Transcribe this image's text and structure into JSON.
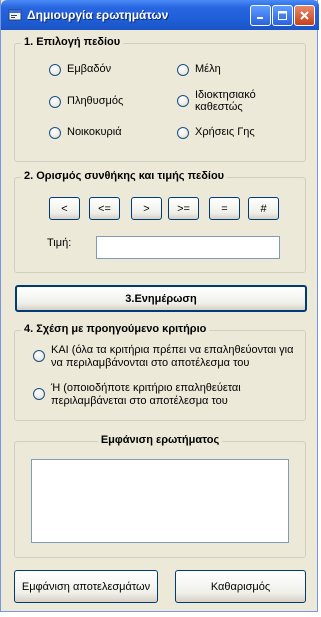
{
  "window": {
    "title": "Δημιουργία ερωτημάτων"
  },
  "field_group": {
    "legend": "1. Επιλογή πεδίου",
    "options": [
      "Εμβαδόν",
      "Μέλη",
      "Πληθυσμός",
      "Ιδιοκτησιακό καθεστώς",
      "Νοικοκυριά",
      "Χρήσεις Γης"
    ]
  },
  "condition_group": {
    "legend": "2. Ορισμός συνθήκης και τιμής πεδίου",
    "operators": [
      "<",
      "<=",
      ">",
      ">=",
      "=",
      "#"
    ],
    "value_label": "Τιμή:",
    "value": ""
  },
  "update_button": "3.Ενημέρωση",
  "relation_group": {
    "legend": "4. Σχέση με προηγούμενο κριτήριο",
    "and_text": "ΚΑΙ (όλα τα κριτήρια πρέπει να επαληθεύονται για να περιλαμβάνονται στο αποτέλεσμα του",
    "or_text": "Ή (οποιοδήποτε κριτήριο επαληθεύεται περιλαμβάνεται στο αποτέλεσμα του"
  },
  "query_group": {
    "legend": "Εμφάνιση ερωτήματος",
    "query_text": ""
  },
  "footer": {
    "show_results": "Εμφάνιση αποτελεσμάτων",
    "clear": "Καθαρισμός"
  }
}
